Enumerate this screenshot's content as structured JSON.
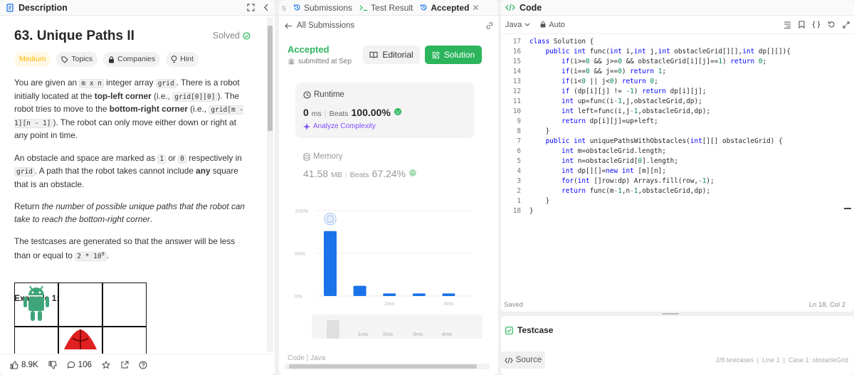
{
  "left": {
    "tab_label": "Description",
    "title": "63. Unique Paths II",
    "solved_label": "Solved",
    "tags": {
      "difficulty": "Medium",
      "topics": "Topics",
      "companies": "Companies",
      "hint": "Hint"
    },
    "p1": {
      "a": "You are given an ",
      "m_x_n": "m x n",
      "b": " integer array ",
      "grid": "grid",
      "c": ". There is a robot initially located at the ",
      "top_left": "top-left corner",
      "d": " (i.e., ",
      "g00": "grid[0][0]",
      "e": "). The robot tries to move to the ",
      "bottom_right": "bottom-right corner",
      "f": " (i.e., ",
      "gmn": "grid[m - 1][n - 1]",
      "g": "). The robot can only move either down or right at any point in time."
    },
    "p2": {
      "a": "An obstacle and space are marked as ",
      "one": "1",
      "b": " or ",
      "zero": "0",
      "c": " respectively in ",
      "grid": "grid",
      "d": ". A path that the robot takes cannot include ",
      "any": "any",
      "e": " square that is an obstacle."
    },
    "p3": {
      "a": "Return ",
      "b": "the number of possible unique paths that the robot can take to reach the bottom-right corner",
      "c": "."
    },
    "p4": {
      "a": "The testcases are generated so that the answer will be less than or equal to ",
      "b": "2 * 10",
      "exp": "9",
      "c": "."
    },
    "example_label": "Example 1:",
    "footer": {
      "likes": "8.9K",
      "comments": "106"
    }
  },
  "mid": {
    "tabs": {
      "t0": "s",
      "t1": "Submissions",
      "t2": "Test Result",
      "t3": "Accepted"
    },
    "back_label": "All Submissions",
    "status": "Accepted",
    "submitted": "submitted at Sep",
    "editorial_label": "Editorial",
    "solution_label": "Solution",
    "runtime": {
      "label": "Runtime",
      "value": "0",
      "unit": "ms",
      "beats_label": "Beats",
      "beats": "100.00%",
      "analyze": "Analyze Complexity"
    },
    "memory": {
      "label": "Memory",
      "value": "41.58",
      "unit": "MB",
      "beats_label": "Beats",
      "beats": "67.24%"
    },
    "code_label": "Code",
    "lang_label": "Java"
  },
  "chart_data": {
    "type": "bar",
    "y_ticks": [
      "100%",
      "50%",
      "0%"
    ],
    "ylim": [
      0,
      100
    ],
    "categories": [
      "",
      "",
      "2ms",
      "",
      "4ms"
    ],
    "values": [
      76,
      12,
      3,
      3,
      3
    ],
    "highlight_index": 0,
    "range_labels": [
      "1ms",
      "2ms",
      "3ms",
      "4ms"
    ],
    "bar_color": "#1a73e8"
  },
  "right": {
    "tab_label": "Code",
    "lang": "Java",
    "mode": "Auto",
    "lines": [
      {
        "n": "17",
        "t": "class Solution {"
      },
      {
        "n": "16",
        "t": "    public int func(int i,int j,int obstacleGrid[][],int dp[][]){"
      },
      {
        "n": "15",
        "t": "        if(i>=0 && j>=0 && obstacleGrid[i][j]==1) return 0;"
      },
      {
        "n": "14",
        "t": "        if(i==0 && j==0) return 1;"
      },
      {
        "n": "13",
        "t": "        if(i<0 || j<0) return 0;"
      },
      {
        "n": "12",
        "t": "        if (dp[i][j] != -1) return dp[i][j];"
      },
      {
        "n": "11",
        "t": "        int up=func(i-1,j,obstacleGrid,dp);"
      },
      {
        "n": "10",
        "t": "        int left=func(i,j-1,obstacleGrid,dp);"
      },
      {
        "n": "9",
        "t": "        return dp[i][j]=up+left;"
      },
      {
        "n": "8",
        "t": "    }"
      },
      {
        "n": "7",
        "t": "    public int uniquePathsWithObstacles(int[][] obstacleGrid) {"
      },
      {
        "n": "6",
        "t": "        int m=obstacleGrid.length;"
      },
      {
        "n": "5",
        "t": "        int n=obstacleGrid[0].length;"
      },
      {
        "n": "4",
        "t": "        int dp[][]=new int [m][n];"
      },
      {
        "n": "3",
        "t": "        for(int []row:dp) Arrays.fill(row,-1);"
      },
      {
        "n": "2",
        "t": "        return func(m-1,n-1,obstacleGrid,dp);"
      },
      {
        "n": "1",
        "t": "    }"
      },
      {
        "n": "18",
        "t": "}"
      }
    ],
    "saved": "Saved",
    "cursor": "Ln 18, Col 2"
  },
  "testcase": {
    "label": "Testcase",
    "source_label": "Source",
    "status": "2/8 testcases  |  Line 1  |  Case 1: obstacleGrid"
  }
}
